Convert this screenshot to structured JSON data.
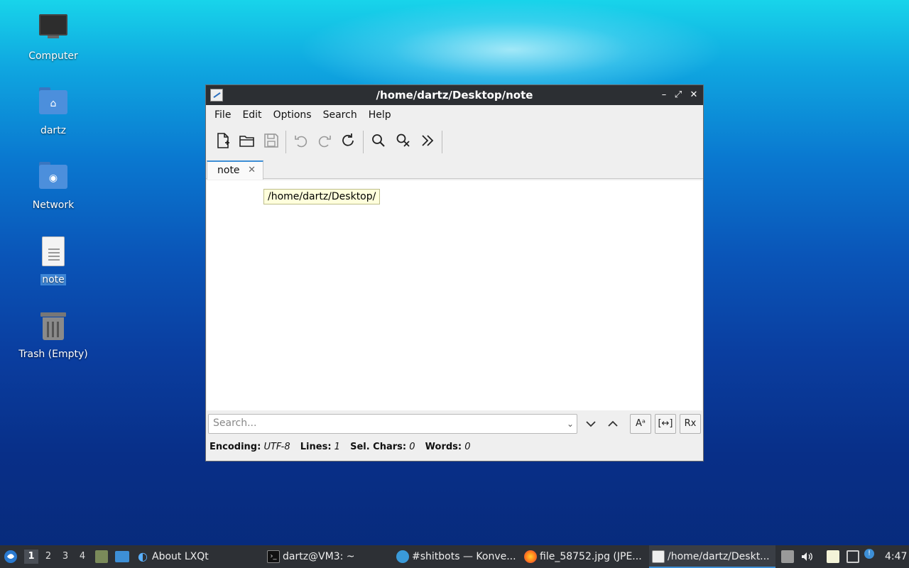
{
  "desktop": {
    "icons": [
      {
        "label": "Computer"
      },
      {
        "label": "dartz"
      },
      {
        "label": "Network"
      },
      {
        "label": "note"
      },
      {
        "label": "Trash (Empty)"
      }
    ]
  },
  "window": {
    "title": "/home/dartz/Desktop/note",
    "controls": {
      "minimize": "–",
      "maximize": "⤢",
      "close": "✕"
    },
    "menu": [
      "File",
      "Edit",
      "Options",
      "Search",
      "Help"
    ],
    "tab": {
      "label": "note",
      "close": "✕"
    },
    "tooltip": "/home/dartz/Desktop/",
    "search": {
      "placeholder": "Search...",
      "case_btn": "Aᵃ",
      "whole_btn": "[↔]",
      "regex_btn": "Rx"
    },
    "status": {
      "encoding_label": "Encoding:",
      "encoding_value": "UTF-8",
      "lines_label": "Lines:",
      "lines_value": "1",
      "selchars_label": "Sel. Chars:",
      "selchars_value": "0",
      "words_label": "Words:",
      "words_value": "0"
    }
  },
  "taskbar": {
    "desktops": [
      "1",
      "2",
      "3",
      "4"
    ],
    "tasks": [
      {
        "label": "About LXQt"
      },
      {
        "label": "dartz@VM3: ~"
      },
      {
        "label": "#shitbots — Konve..."
      },
      {
        "label": "file_58752.jpg (JPE..."
      },
      {
        "label": "/home/dartz/Deskt..."
      }
    ],
    "clock": "4:47"
  },
  "colors": {
    "accent": "#3d8fd6",
    "taskbar_bg": "#2d3035",
    "titlebar_bg": "#2c2f33"
  }
}
